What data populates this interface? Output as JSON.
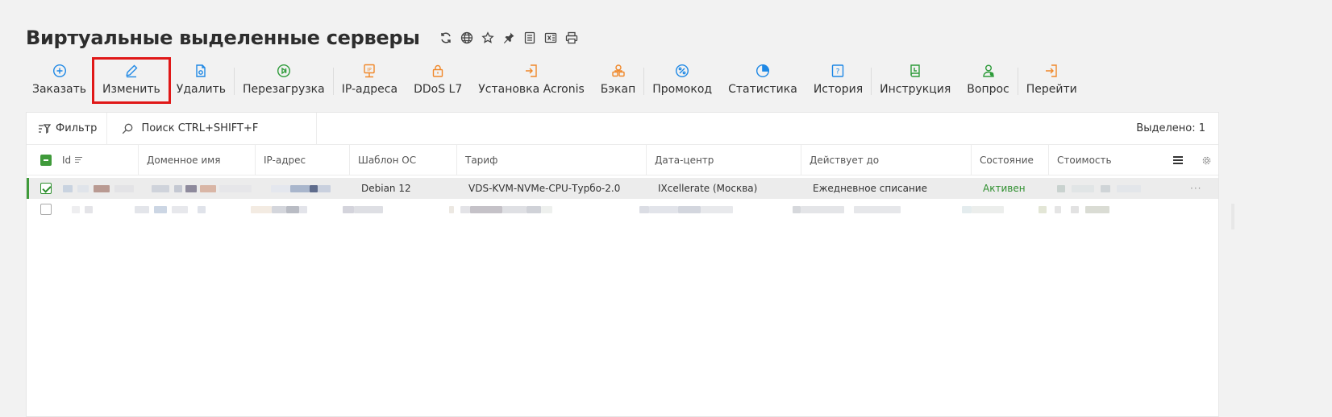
{
  "page": {
    "title": "Виртуальные выделенные серверы",
    "title_icons": [
      "refresh-icon",
      "globe-icon",
      "star-icon",
      "pin-icon",
      "notes-icon",
      "excel-icon",
      "print-icon"
    ]
  },
  "toolbar": {
    "buttons": [
      {
        "label": "Заказать",
        "icon": "plus-circle-icon",
        "color": "#1e88e5"
      },
      {
        "label": "Изменить",
        "icon": "pencil-icon",
        "color": "#1e88e5"
      },
      {
        "label": "Удалить",
        "icon": "delete-doc-icon",
        "color": "#1e88e5"
      },
      {
        "label": "Перезагрузка",
        "icon": "restart-icon",
        "color": "#2e9b3a"
      },
      {
        "label": "IP-адреса",
        "icon": "ip-icon",
        "color": "#f0882a"
      },
      {
        "label": "DDoS L7",
        "icon": "lock-icon",
        "color": "#f0882a"
      },
      {
        "label": "Установка Acronis",
        "icon": "install-icon",
        "color": "#f0882a"
      },
      {
        "label": "Бэкап",
        "icon": "backup-icon",
        "color": "#f0882a"
      },
      {
        "label": "Промокод",
        "icon": "percent-icon",
        "color": "#1e88e5"
      },
      {
        "label": "Статистика",
        "icon": "pie-chart-icon",
        "color": "#1e88e5"
      },
      {
        "label": "История",
        "icon": "history-icon",
        "color": "#1e88e5"
      },
      {
        "label": "Инструкция",
        "icon": "book-icon",
        "color": "#2e9b3a"
      },
      {
        "label": "Вопрос",
        "icon": "support-icon",
        "color": "#2e9b3a"
      },
      {
        "label": "Перейти",
        "icon": "goto-icon",
        "color": "#f0882a"
      }
    ]
  },
  "filter": {
    "label": "Фильтр",
    "search_placeholder": "Поиск CTRL+SHIFT+F",
    "selected_label": "Выделено: 1"
  },
  "table": {
    "columns": [
      "Id",
      "Доменное имя",
      "IP-адрес",
      "Шаблон ОС",
      "Тариф",
      "Дата-центр",
      "Действует до",
      "Состояние",
      "Стоимость"
    ],
    "rows": [
      {
        "selected": true,
        "os": "Debian 12",
        "tariff": "VDS-KVM-NVMe-CPU-Турбо-2.0",
        "datacenter": "IXcellerate (Москва)",
        "valid_until": "Ежедневное списание",
        "status": "Активен",
        "menu": "···"
      }
    ]
  },
  "colors": {
    "accent_green": "#3f9a3a",
    "highlight_red": "#e01818",
    "status_active": "#2e8f2e"
  }
}
